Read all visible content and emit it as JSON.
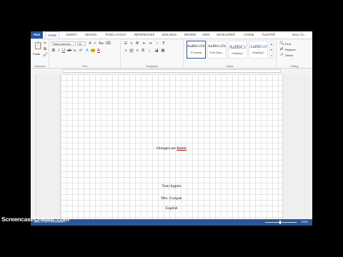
{
  "tabs": [
    "FILE",
    "HOME",
    "INSERT",
    "DESIGN",
    "PAGE LAYOUT",
    "REFERENCES",
    "MAILINGS",
    "REVIEW",
    "VIEW",
    "DEVELOPER",
    "Acrobat",
    "Foxit PDF"
  ],
  "user": "Mary Cin...",
  "ribbon": {
    "clipboard": {
      "paste": "Paste",
      "label": "Clipboard"
    },
    "font": {
      "name": "Times New Ro",
      "size": "12",
      "label": "Font"
    },
    "paragraph": {
      "label": "Paragraph"
    },
    "styles": {
      "label": "Styles",
      "items": [
        {
          "sample": "AaBbCcDc",
          "name": "¶ Normal"
        },
        {
          "sample": "AaBbCcDc",
          "name": "¶ No Spac..."
        },
        {
          "sample": "AaBbCc",
          "name": "Heading 1"
        },
        {
          "sample": "AaBbCcC",
          "name": "Heading 2"
        }
      ]
    },
    "editing": {
      "find": "Find",
      "replace": "Replace",
      "select": "Select",
      "label": "Editing"
    }
  },
  "document": {
    "title_prefix": "Oranges are ",
    "title_underlined": "Better",
    "lines": [
      "Tran Apples",
      "Mrs. Guzpan",
      "English"
    ]
  },
  "status": {
    "left": "PAGE 1 OF 1   36 WORDS",
    "zoom": "100%"
  },
  "watermark": "Screencast-O-Matic.com",
  "colors": {
    "accent": "#2b579a"
  }
}
